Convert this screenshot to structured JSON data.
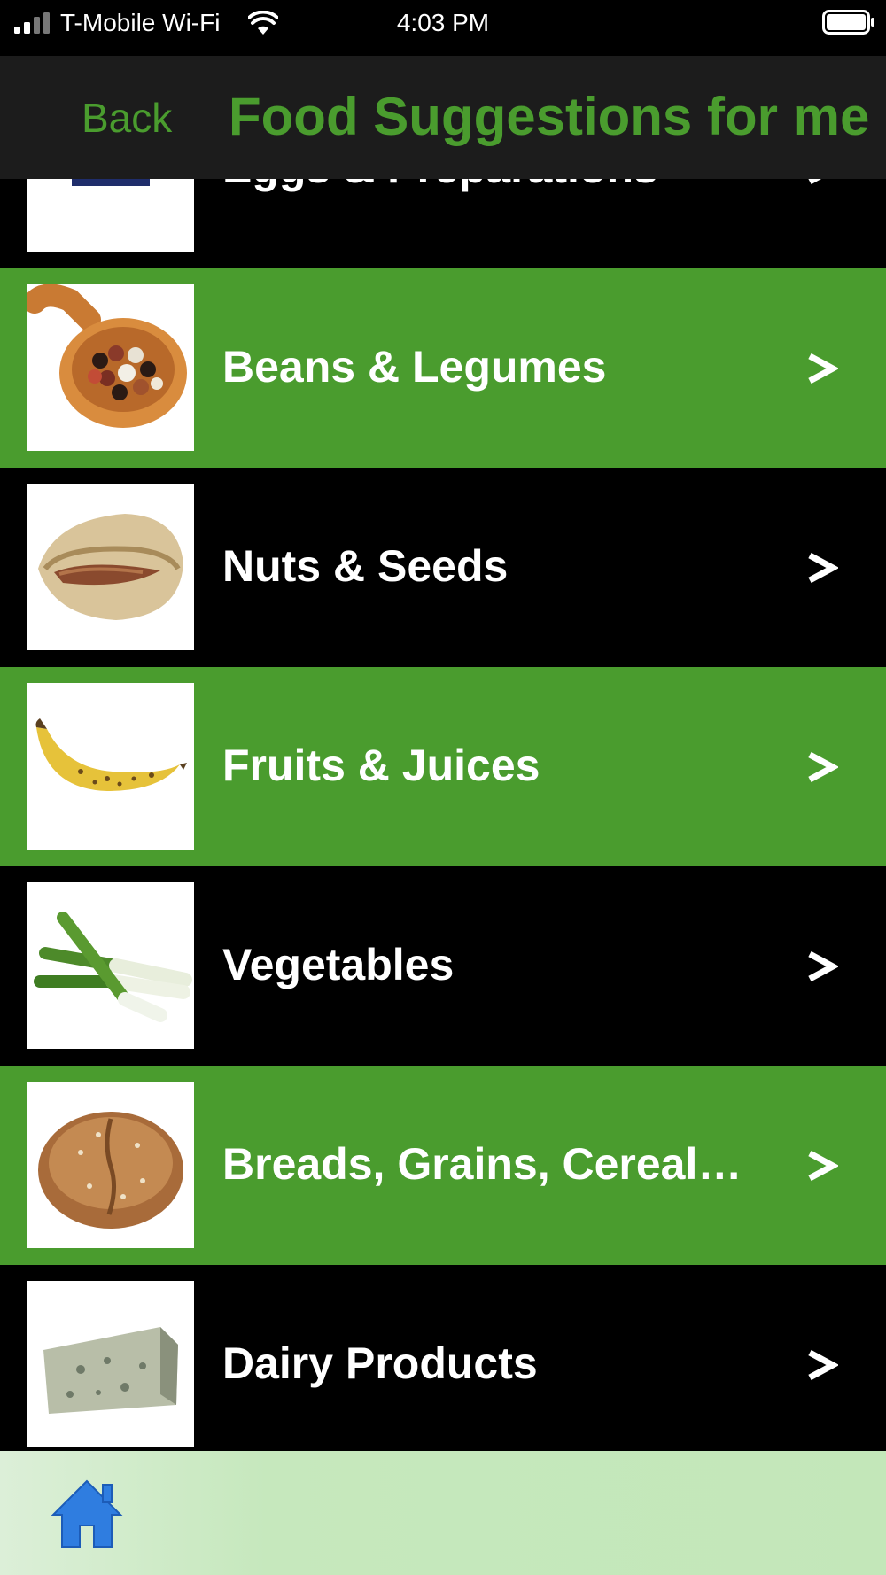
{
  "status_bar": {
    "carrier": "T-Mobile Wi-Fi",
    "time": "4:03 PM",
    "icons": [
      "signal-icon",
      "wifi-icon",
      "battery-icon"
    ]
  },
  "nav": {
    "back_label": "Back",
    "title": "Food Suggestions for me"
  },
  "categories": [
    {
      "label": "Eggs & Preparations",
      "icon": "egg-cup-icon",
      "style": "black"
    },
    {
      "label": "Beans & Legumes",
      "icon": "beans-spoon-icon",
      "style": "green"
    },
    {
      "label": "Nuts & Seeds",
      "icon": "pistachio-icon",
      "style": "black"
    },
    {
      "label": "Fruits & Juices",
      "icon": "banana-icon",
      "style": "green"
    },
    {
      "label": "Vegetables",
      "icon": "leeks-icon",
      "style": "black"
    },
    {
      "label": "Breads, Grains, Cereal…",
      "icon": "bread-loaf-icon",
      "style": "green"
    },
    {
      "label": "Dairy Products",
      "icon": "cheese-icon",
      "style": "black"
    }
  ],
  "tab_bar": {
    "icon": "home-icon"
  },
  "colors": {
    "accent_green": "#4a9c2e",
    "row_black": "#000000",
    "nav_background": "#1c1c1c",
    "tab_bar_green": "#c3e7b9",
    "home_blue": "#2f7de0"
  }
}
